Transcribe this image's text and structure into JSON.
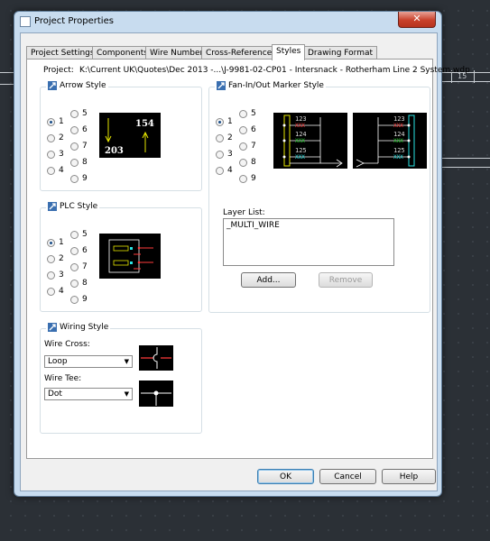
{
  "window": {
    "title": "Project Properties",
    "close_glyph": "✕"
  },
  "tabs": [
    {
      "label": "Project Settings",
      "active": false
    },
    {
      "label": "Components",
      "active": false
    },
    {
      "label": "Wire Numbers",
      "active": false
    },
    {
      "label": "Cross-References",
      "active": false
    },
    {
      "label": "Styles",
      "active": true
    },
    {
      "label": "Drawing Format",
      "active": false
    }
  ],
  "project": {
    "label": "Project:",
    "path": "K:\\Current UK\\Quotes\\Dec 2013 -...\\J-9981-02-CP01 - Intersnack - Rotherham Line 2 System.wdp"
  },
  "arrow_style": {
    "title": "Arrow Style",
    "options": [
      "1",
      "2",
      "3",
      "4",
      "5",
      "6",
      "7",
      "8",
      "9"
    ],
    "selected": "1",
    "preview": {
      "top_number": "154",
      "bottom_number": "203",
      "colors": {
        "arrow": "#e6e600",
        "text": "#ffffff"
      }
    }
  },
  "plc_style": {
    "title": "PLC Style",
    "options": [
      "1",
      "2",
      "3",
      "4",
      "5",
      "6",
      "7",
      "8",
      "9"
    ],
    "selected": "1"
  },
  "fan_style": {
    "title": "Fan-In/Out Marker Style",
    "options": [
      "1",
      "2",
      "3",
      "4",
      "5",
      "6",
      "7",
      "8",
      "9"
    ],
    "selected": "1",
    "preview_numbers": [
      "123",
      "124",
      "125"
    ],
    "preview_xxx": "XXX",
    "colors": {
      "red": "#ff3b3b",
      "green": "#22d12a",
      "cyan": "#29e3e3",
      "yellow": "#e6e600"
    }
  },
  "layer": {
    "label": "Layer List:",
    "items": [
      "_MULTI_WIRE"
    ],
    "add_label": "Add...",
    "remove_label": "Remove"
  },
  "wiring_style": {
    "title": "Wiring Style",
    "wire_cross_label": "Wire Cross:",
    "wire_cross_value": "Loop",
    "wire_tee_label": "Wire Tee:",
    "wire_tee_value": "Dot"
  },
  "buttons": {
    "ok": "OK",
    "cancel": "Cancel",
    "help": "Help"
  },
  "background": {
    "marker_label": "15"
  }
}
